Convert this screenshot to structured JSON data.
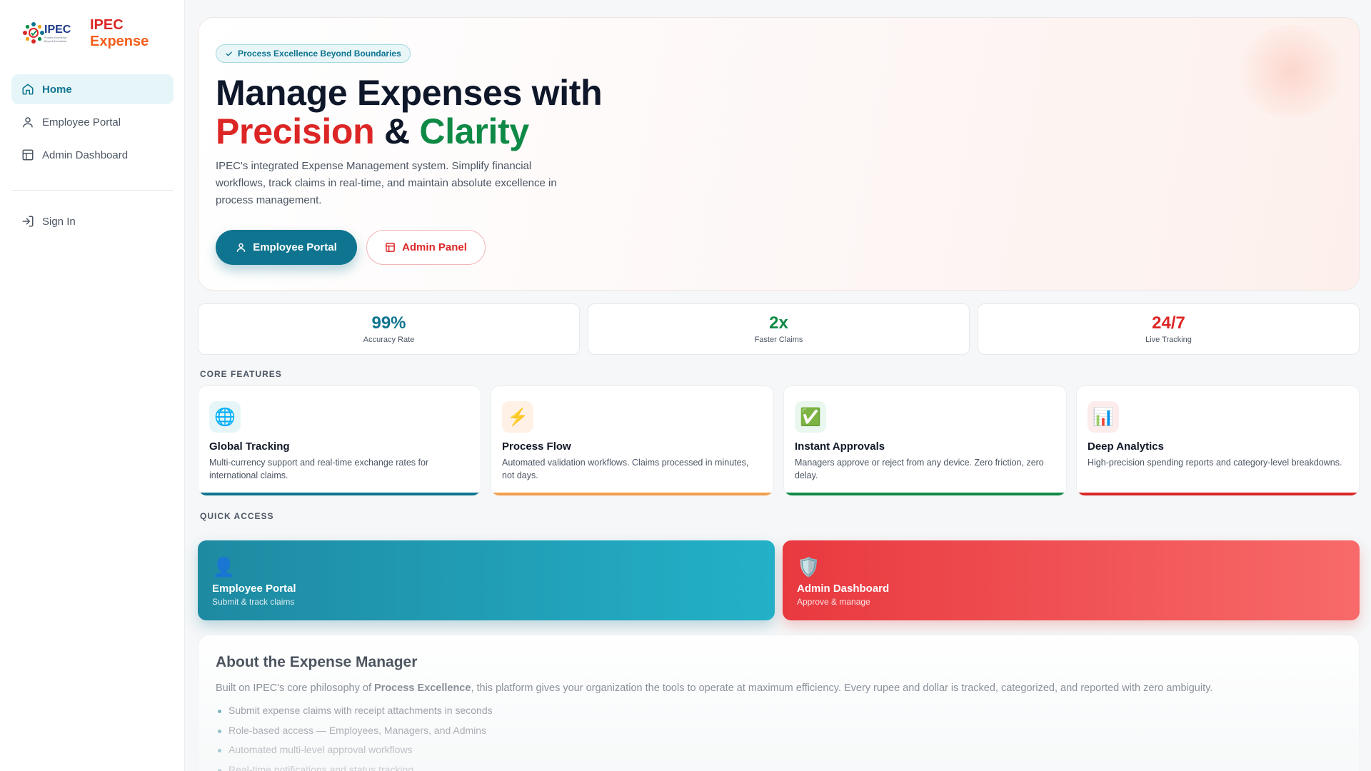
{
  "brand": {
    "line1": "IPEC",
    "line2": "Expense",
    "logo_text": "IPEC",
    "logo_tagline": "Process Excellence Beyond Boundaries"
  },
  "sidebar": {
    "items": [
      {
        "label": "Home",
        "icon": "home-icon",
        "active": true
      },
      {
        "label": "Employee Portal",
        "icon": "user-icon"
      },
      {
        "label": "Admin Dashboard",
        "icon": "layout-icon"
      }
    ],
    "signin": {
      "label": "Sign In",
      "icon": "sign-in-icon"
    }
  },
  "hero": {
    "badge": "Process Excellence Beyond Boundaries",
    "title_line1": "Manage Expenses with",
    "title_precision": "Precision",
    "title_amp": "&",
    "title_clarity": "Clarity",
    "description": "IPEC's integrated Expense Management system. Simplify financial workflows, track claims in real-time, and maintain absolute excellence in process management.",
    "primary_button": "Employee Portal",
    "secondary_button": "Admin Panel"
  },
  "stats": [
    {
      "value": "99%",
      "label": "Accuracy Rate",
      "color": "#0e7490"
    },
    {
      "value": "2x",
      "label": "Faster Claims",
      "color": "#0f8a46"
    },
    {
      "value": "24/7",
      "label": "Live Tracking",
      "color": "#dc2626"
    }
  ],
  "features_heading": "CORE FEATURES",
  "features": [
    {
      "icon": "globe-icon",
      "glyph": "🌐",
      "title": "Global Tracking",
      "description": "Multi-currency support and real-time exchange rates for international claims.",
      "accent": "#0e7490",
      "icon_bg": "#e6f6f8"
    },
    {
      "icon": "lightning-icon",
      "glyph": "⚡",
      "title": "Process Flow",
      "description": "Automated validation workflows. Claims processed in minutes, not days.",
      "accent": "#f59e4b",
      "icon_bg": "#fff1e6"
    },
    {
      "icon": "check-icon",
      "glyph": "✅",
      "title": "Instant Approvals",
      "description": "Managers approve or reject from any device. Zero friction, zero delay.",
      "accent": "#0f8a46",
      "icon_bg": "#e9f7ee"
    },
    {
      "icon": "chart-icon",
      "glyph": "📊",
      "title": "Deep Analytics",
      "description": "High-precision spending reports and category-level breakdowns.",
      "accent": "#dc2626",
      "icon_bg": "#fdecec"
    }
  ],
  "quick_heading": "QUICK ACCESS",
  "quick_access": [
    {
      "icon": "user-icon",
      "glyph": "👤",
      "title": "Employee Portal",
      "subtitle": "Submit & track claims"
    },
    {
      "icon": "shield-icon",
      "glyph": "🛡️",
      "title": "Admin Dashboard",
      "subtitle": "Approve & manage"
    }
  ],
  "about": {
    "title": "About the Expense Manager",
    "text_before": "Built on IPEC's core philosophy of ",
    "text_bold": "Process Excellence",
    "text_after": ", this platform gives your organization the tools to operate at maximum efficiency. Every rupee and dollar is tracked, categorized, and reported with zero ambiguity.",
    "bullets": [
      "Submit expense claims with receipt attachments in seconds",
      "Role-based access — Employees, Managers, and Admins",
      "Automated multi-level approval workflows",
      "Real-time notifications and status tracking"
    ]
  }
}
